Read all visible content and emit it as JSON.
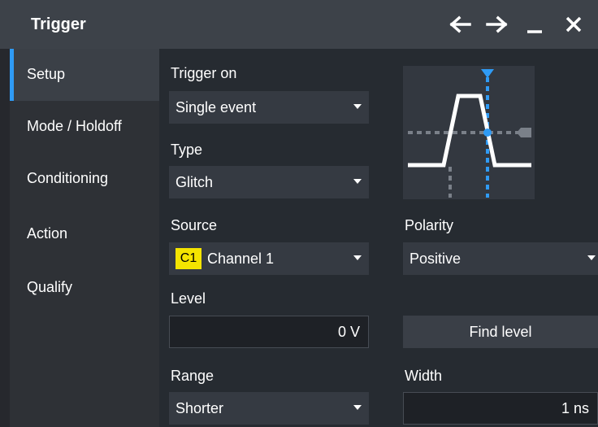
{
  "window": {
    "title": "Trigger"
  },
  "titlebar_buttons": {
    "back": "arrow-left-icon",
    "forward": "arrow-right-icon",
    "minimize": "minimize-icon",
    "close": "close-icon"
  },
  "sidebar": {
    "items": [
      {
        "label": "Setup",
        "active": true
      },
      {
        "label": "Mode / Holdoff",
        "active": false
      },
      {
        "label": "Conditioning",
        "active": false
      },
      {
        "label": "Action",
        "active": false
      },
      {
        "label": "Qualify",
        "active": false
      }
    ]
  },
  "setup": {
    "trigger_on": {
      "label": "Trigger on",
      "value": "Single event"
    },
    "type": {
      "label": "Type",
      "value": "Glitch"
    },
    "source": {
      "label": "Source",
      "badge": "C1",
      "value": "Channel 1"
    },
    "polarity": {
      "label": "Polarity",
      "value": "Positive"
    },
    "level": {
      "label": "Level",
      "value": "0 V"
    },
    "find_level": {
      "label": "Find level"
    },
    "range": {
      "label": "Range",
      "value": "Shorter"
    },
    "width": {
      "label": "Width",
      "value": "1 ns"
    }
  },
  "colors": {
    "accent": "#2f9bf5",
    "channel1": "#f4e400",
    "titlebar": "#3d4249"
  },
  "diagram": {
    "icon": "glitch-positive-pulse-icon"
  }
}
